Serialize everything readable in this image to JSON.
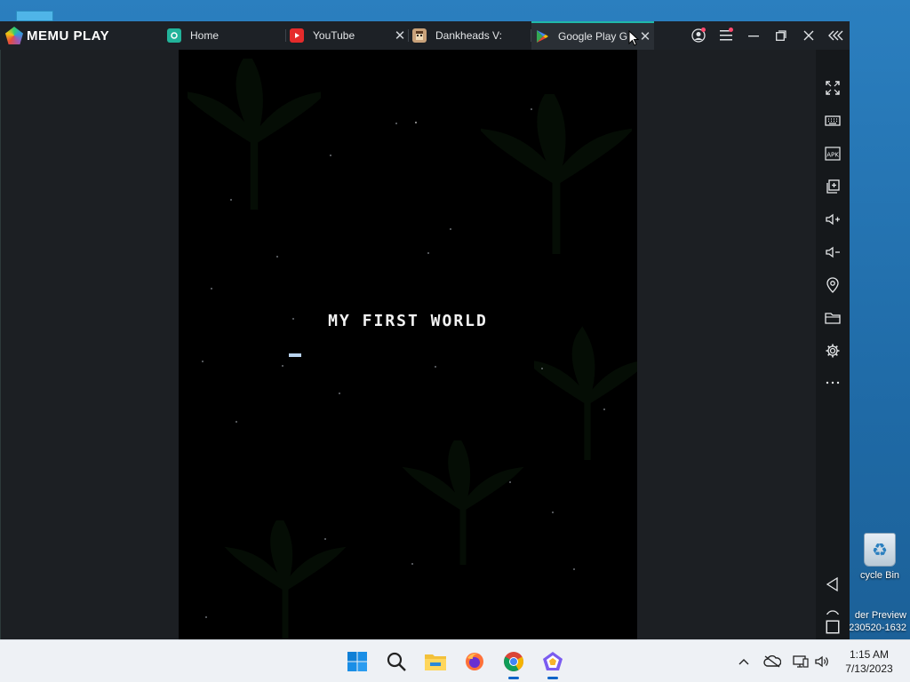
{
  "window": {
    "brand": "MEMU PLAY",
    "tabs": [
      {
        "label": "Home",
        "icon": "memu-home-icon",
        "closable": false
      },
      {
        "label": "YouTube",
        "icon": "youtube-icon",
        "closable": true
      },
      {
        "label": "Dankheads V:",
        "icon": "dankheads-icon",
        "closable": false
      },
      {
        "label": "Google Play G",
        "icon": "google-play-icon",
        "closable": true,
        "active": true
      }
    ],
    "controls": [
      "account-icon",
      "menu-icon",
      "minimize-icon",
      "restore-icon",
      "close-icon",
      "collapse-icon"
    ]
  },
  "game": {
    "title": "MY FIRST WORLD"
  },
  "sidebar": {
    "tools": [
      "fullscreen-icon",
      "keyboard-icon",
      "apk-icon",
      "multi-instance-icon",
      "volume-up-icon",
      "volume-down-icon",
      "location-icon",
      "folder-icon",
      "settings-icon",
      "more-icon"
    ],
    "apk_label": "APK",
    "nav": [
      "back-icon",
      "home-icon",
      "recents-icon"
    ]
  },
  "desktop": {
    "recycle_bin_label": "cycle Bin",
    "watermark_line1": "der Preview",
    "watermark_line2": "230520-1632"
  },
  "taskbar": {
    "apps": [
      "windows-start-icon",
      "search-icon",
      "file-explorer-icon",
      "firefox-icon",
      "chrome-icon",
      "memu-icon"
    ],
    "tray": [
      "chevron-up-icon",
      "onedrive-offline-icon",
      "network-icon",
      "speaker-icon"
    ],
    "time": "1:15 AM",
    "date": "7/13/2023"
  },
  "colors": {
    "accent": "#20b8a8",
    "titlebar": "#1d2126",
    "taskbar": "#eef1f5"
  }
}
